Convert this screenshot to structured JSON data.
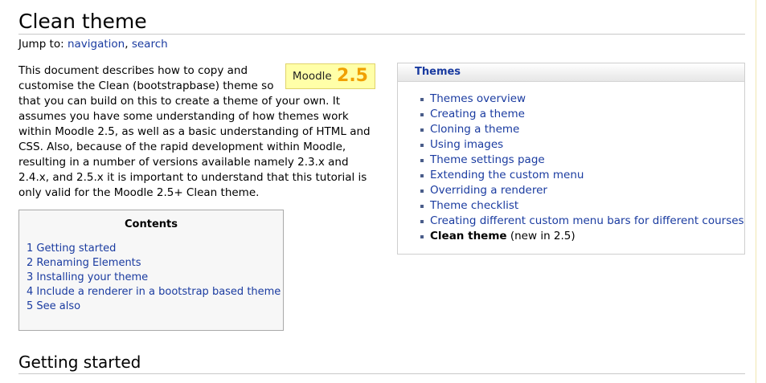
{
  "page_title": "Clean theme",
  "jump_to": {
    "label": "Jump to:",
    "navigation": "navigation",
    "separator": ", ",
    "search": "search"
  },
  "badge": {
    "label": "Moodle",
    "version": "2.5"
  },
  "intro_text": "This document describes how to copy and customise the Clean (bootstrapbase) theme so that you can build on this to create a theme of your own. It assumes you have some understanding of how themes work within Moodle 2.5, as well as a basic understanding of HTML and CSS. Also, because of the rapid development within Moodle, resulting in a number of versions available namely 2.3.x and 2.4.x, and 2.5.x it is important to understand that this tutorial is only valid for the Moodle 2.5+ Clean theme.",
  "toc": {
    "title": "Contents",
    "items": [
      "1 Getting started",
      "2 Renaming Elements",
      "3 Installing your theme",
      "4 Include a renderer in a bootstrap based theme",
      "5 See also"
    ]
  },
  "themes_box": {
    "title": "Themes",
    "links": [
      "Themes overview",
      "Creating a theme",
      "Cloning a theme",
      "Using images",
      "Theme settings page",
      "Extending the custom menu",
      "Overriding a renderer",
      "Theme checklist",
      "Creating different custom menu bars for different courses"
    ],
    "current": {
      "label": "Clean theme",
      "note": "(new in 2.5)"
    }
  },
  "section_heading": "Getting started",
  "colors": {
    "link": "#1a3ba0",
    "badge_bg": "#ffffa8",
    "badge_version": "#f0a000",
    "toc_bg": "#f7f7f7"
  }
}
